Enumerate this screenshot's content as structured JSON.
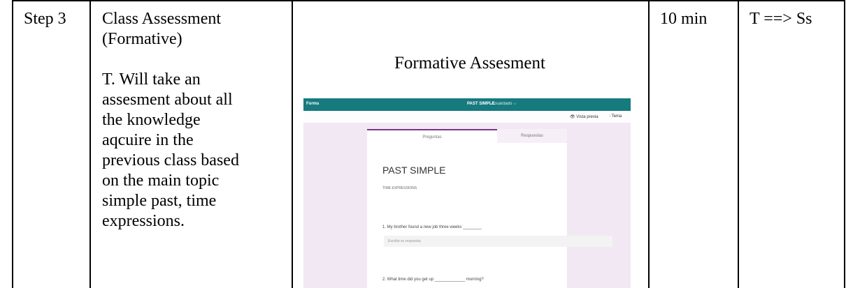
{
  "row": {
    "step": "Step 3",
    "activity": {
      "heading_line1": "Class Assessment",
      "heading_line2": "(Formative)",
      "description_lines": [
        "T. Will take an",
        "assesment about all",
        "the knowledge",
        "aqcuire in the",
        "previous class based",
        "on the main topic",
        "simple past, time",
        "expressions."
      ]
    },
    "resource_caption": "Formative Assesment",
    "time": "10 min",
    "interaction": "T ==> Ss"
  },
  "forms_screenshot": {
    "brand": "Forms",
    "document_title": "PAST SIMPLE",
    "save_status": "- Guardado ⌵",
    "preview_label": "Vista previa",
    "theme_label": "Tema",
    "tabs": [
      "Preguntas",
      "Respuestas"
    ],
    "form_title": "PAST SIMPLE",
    "form_subtitle": "TIME EXPRESSIONS",
    "questions": [
      "1. My brother found a new job three weeks ________",
      "2. What time did you get up _____________ morning?"
    ],
    "answer_placeholder": "Escriba su respuesta",
    "colors": {
      "header": "#167a7f",
      "accent": "#7b3585",
      "background": "#f1e8f3"
    },
    "icons": [
      "eye-icon",
      "theme-icon"
    ]
  }
}
